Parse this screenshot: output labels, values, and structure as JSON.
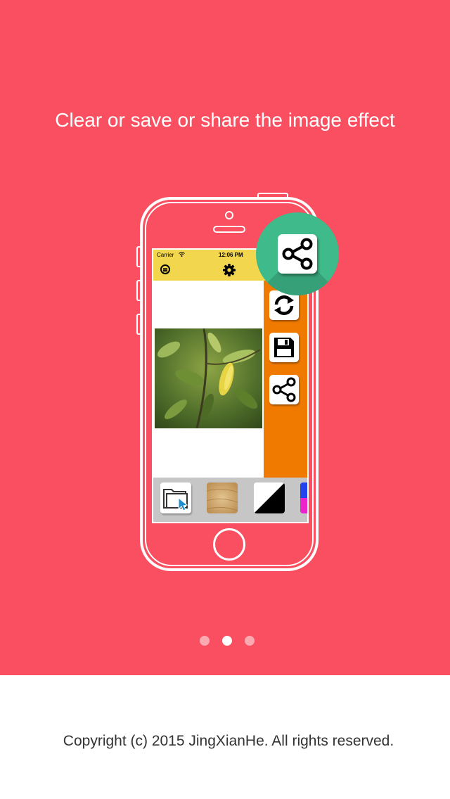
{
  "hero": {
    "headline": "Clear or save or share the image effect",
    "background": "#f94f60"
  },
  "mock_screen": {
    "status": {
      "carrier": "Carrier",
      "time": "12:06 PM"
    },
    "nav_bg": "#f2d64e",
    "panel_bg": "#f07a00",
    "tools": [
      "refresh-icon",
      "save-icon",
      "share-icon"
    ],
    "thumbnails": [
      "folder-icon",
      "texture-thumbnail",
      "contrast-thumbnail",
      "color-thumbnail"
    ]
  },
  "highlight": {
    "icon": "share-icon",
    "color": "#3fba8a"
  },
  "pager": {
    "count": 3,
    "active_index": 1
  },
  "footer": {
    "copyright": "Copyright (c) 2015 JingXianHe. All rights reserved."
  }
}
